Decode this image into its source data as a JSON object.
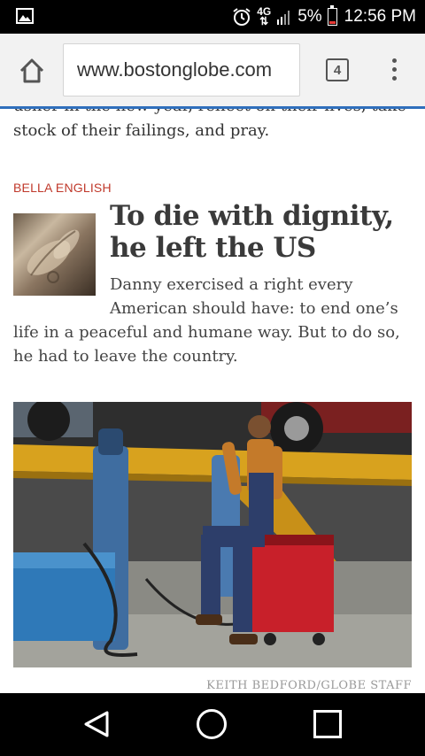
{
  "status_bar": {
    "network": "4G",
    "battery": "5%",
    "time": "12:56 PM",
    "icons": [
      "gallery-icon",
      "alarm-icon",
      "signal-icon",
      "battery-icon"
    ]
  },
  "browser": {
    "url": "www.bostonglobe.com",
    "tab_count": "4",
    "accent": "#2f6fbc",
    "icons": [
      "home-icon",
      "tabs-icon",
      "overflow-menu-icon"
    ]
  },
  "article": {
    "previous_text": "usher in the new year, reflect on their lives, take stock of their failings, and pray.",
    "byline": "BELLA ENGLISH",
    "headline": "To die with dignity, he left the US",
    "summary": "Danny exercised a right every American should have: to end one’s life in a peaceful and humane way. But to do so, he had to leave the country.",
    "photo_credit": "KEITH BEDFORD/GLOBE STAFF",
    "byline_color": "#c0392b"
  },
  "nav_bar": {
    "icons": [
      "back-icon",
      "home-circle-icon",
      "recents-icon"
    ]
  }
}
